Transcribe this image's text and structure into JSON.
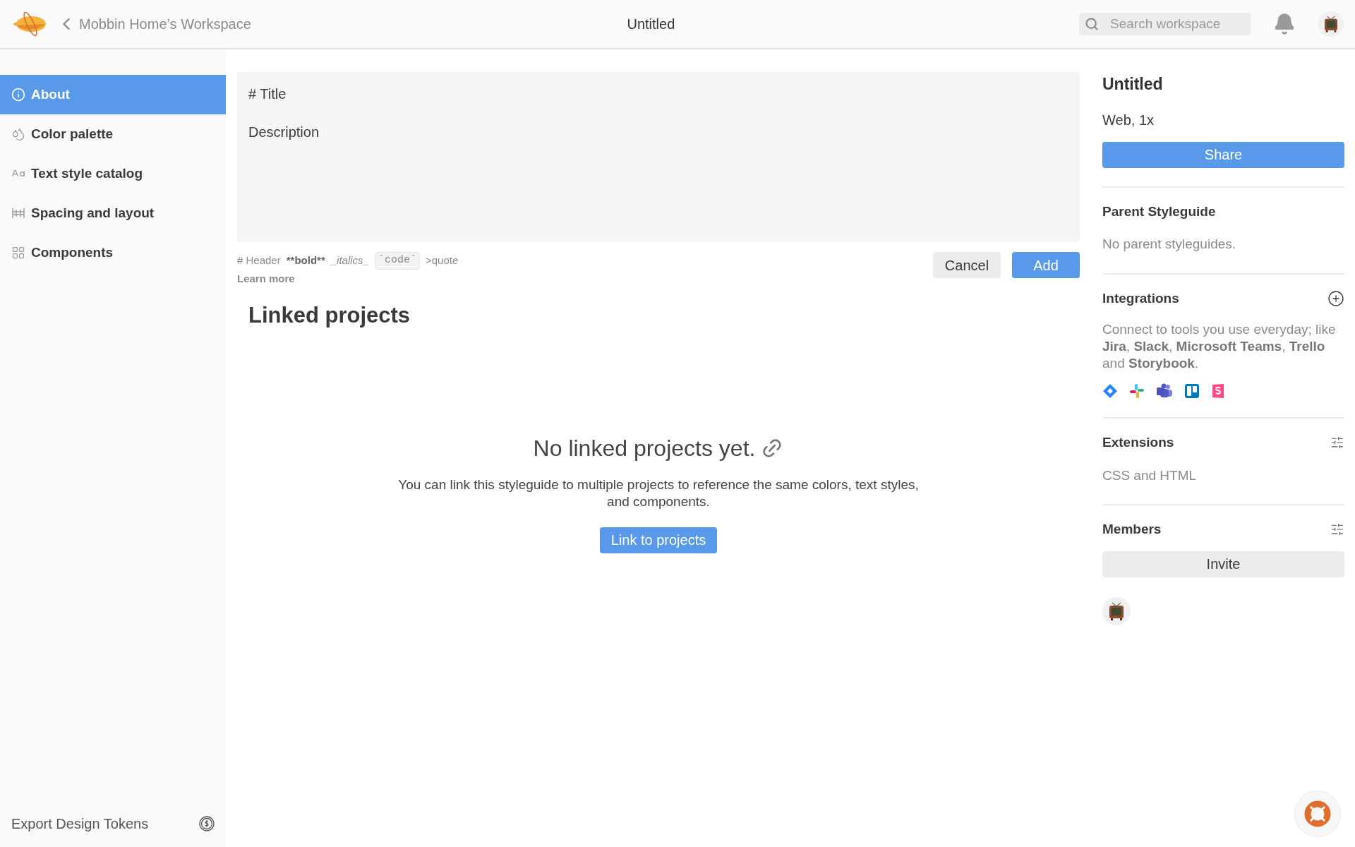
{
  "header": {
    "back_label": "Mobbin Home’s Workspace",
    "title": "Untitled",
    "search": {
      "placeholder": "Search workspace"
    }
  },
  "sidebar": {
    "items": [
      {
        "label": "About",
        "selected": true
      },
      {
        "label": "Color palette",
        "selected": false
      },
      {
        "label": "Text style catalog",
        "selected": false
      },
      {
        "label": "Spacing and layout",
        "selected": false
      },
      {
        "label": "Components",
        "selected": false
      }
    ],
    "footer": {
      "label": "Export Design Tokens"
    }
  },
  "editor": {
    "title_placeholder": "# Title",
    "description_placeholder": "Description",
    "hints": [
      {
        "text": "# Header",
        "kind": "plain"
      },
      {
        "text": "**bold**",
        "kind": "bold"
      },
      {
        "text": "_italics_",
        "kind": "italic"
      },
      {
        "text": "`code`",
        "kind": "code"
      },
      {
        "text": ">quote",
        "kind": "plain"
      }
    ],
    "learn_more": "Learn more",
    "buttons": [
      {
        "label": "Cancel",
        "kind": "secondary"
      },
      {
        "label": "Add",
        "kind": "primary"
      }
    ]
  },
  "linked_projects": {
    "heading": "Linked projects",
    "empty_title": "No linked projects yet.",
    "empty_text": "You can link this styleguide to multiple projects to reference the same colors, text styles, and components.",
    "button": "Link to projects"
  },
  "details": {
    "title": "Untitled",
    "platform": "Web, 1x",
    "share": "Share",
    "sections": [
      {
        "heading": "Parent Styleguide",
        "kind": "parent",
        "text": "No parent styleguides."
      },
      {
        "heading": "Integrations",
        "kind": "integrations",
        "text": "Connect to tools you use everyday; like **Jira**, **Slack**, **Microsoft Teams**, **Trello** and **Storybook**."
      },
      {
        "heading": "Extensions",
        "kind": "extensions",
        "text": "CSS and HTML"
      },
      {
        "heading": "Members",
        "kind": "members",
        "button": "Invite"
      }
    ]
  }
}
